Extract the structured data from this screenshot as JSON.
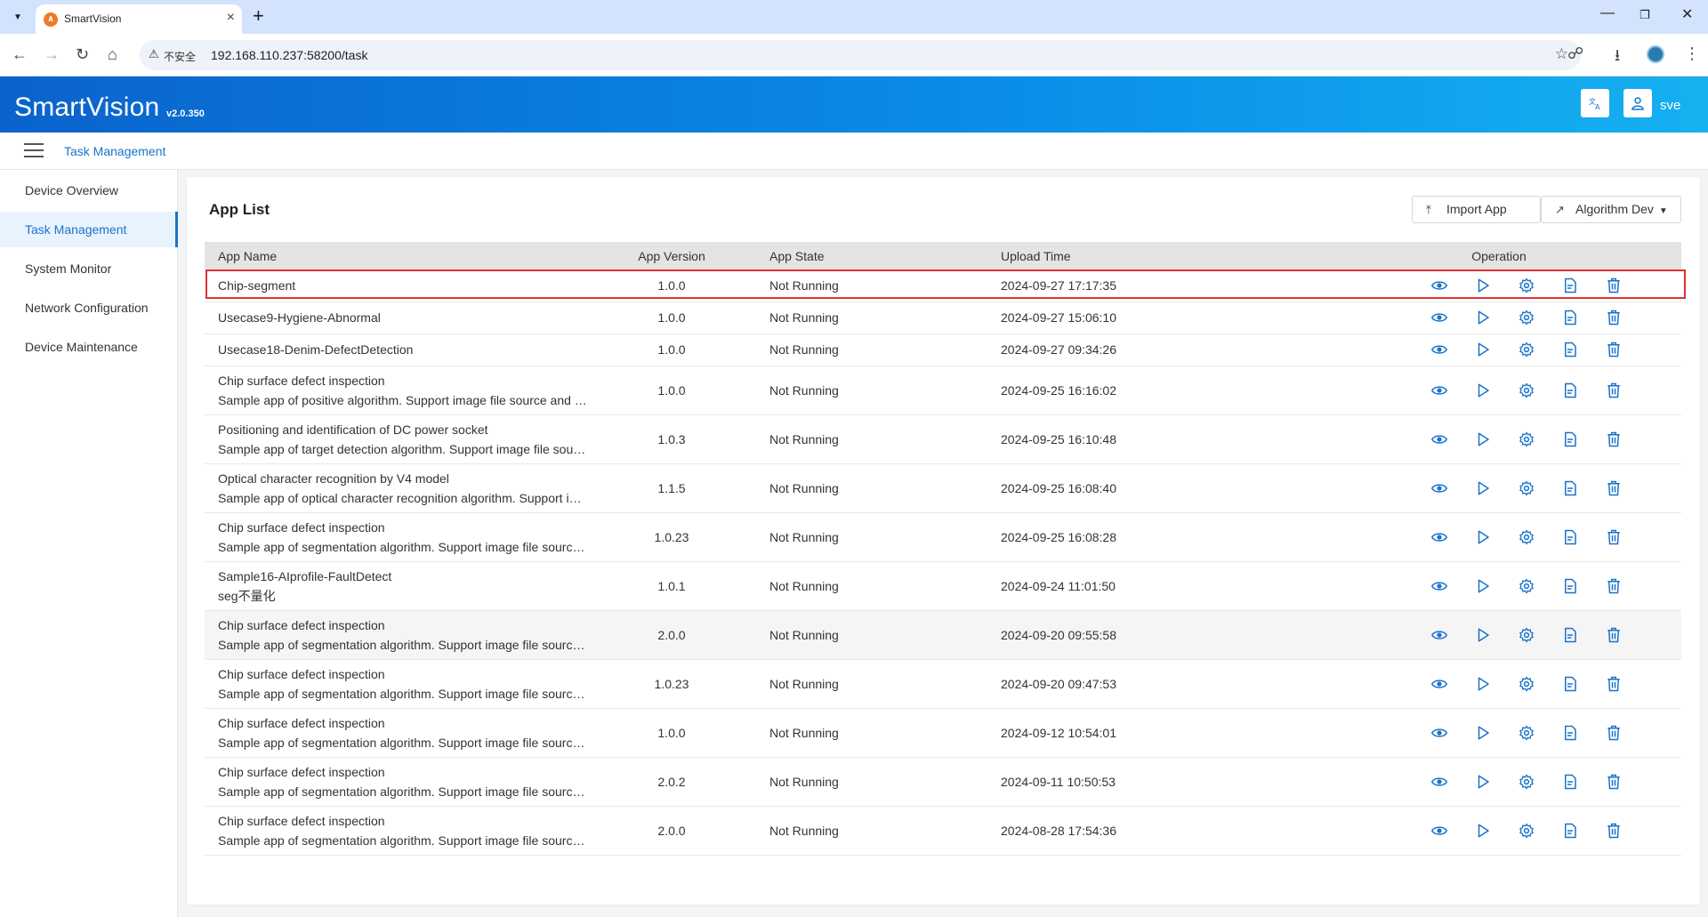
{
  "browser": {
    "tab_title": "SmartVision",
    "security_label": "不安全",
    "url": "192.168.110.237:58200/task"
  },
  "header": {
    "brand": "SmartVision",
    "version": "v2.0.350",
    "username": "sve"
  },
  "breadcrumb": {
    "current": "Task Management"
  },
  "sidebar": {
    "items": [
      {
        "label": "Device Overview",
        "active": false
      },
      {
        "label": "Task Management",
        "active": true
      },
      {
        "label": "System Monitor",
        "active": false
      },
      {
        "label": "Network Configuration",
        "active": false
      },
      {
        "label": "Device Maintenance",
        "active": false
      }
    ]
  },
  "main": {
    "title": "App List",
    "import_label": "Import App",
    "algo_label": "Algorithm Dev",
    "columns": {
      "name": "App Name",
      "version": "App Version",
      "state": "App State",
      "upload": "Upload Time",
      "operation": "Operation"
    },
    "rows": [
      {
        "name": "Chip-segment",
        "desc": "",
        "version": "1.0.0",
        "state": "Not Running",
        "upload": "2024-09-27 17:17:35"
      },
      {
        "name": "Usecase9-Hygiene-Abnormal",
        "desc": "",
        "version": "1.0.0",
        "state": "Not Running",
        "upload": "2024-09-27 15:06:10"
      },
      {
        "name": "Usecase18-Denim-DefectDetection",
        "desc": "",
        "version": "1.0.0",
        "state": "Not Running",
        "upload": "2024-09-27 09:34:26"
      },
      {
        "name": "Chip surface defect inspection",
        "desc": "Sample app of positive algorithm. Support image file source and c...",
        "version": "1.0.0",
        "state": "Not Running",
        "upload": "2024-09-25 16:16:02"
      },
      {
        "name": "Positioning and identification of DC power socket",
        "desc": "Sample app of target detection algorithm. Support image file sourc...",
        "version": "1.0.3",
        "state": "Not Running",
        "upload": "2024-09-25 16:10:48"
      },
      {
        "name": "Optical character recognition by V4 model",
        "desc": "Sample app of optical character recognition algorithm. Support ima...",
        "version": "1.1.5",
        "state": "Not Running",
        "upload": "2024-09-25 16:08:40"
      },
      {
        "name": "Chip surface defect inspection",
        "desc": "Sample app of segmentation algorithm. Support image file source ...",
        "version": "1.0.23",
        "state": "Not Running",
        "upload": "2024-09-25 16:08:28"
      },
      {
        "name": "Sample16-AIprofile-FaultDetect",
        "desc": "seg不量化",
        "version": "1.0.1",
        "state": "Not Running",
        "upload": "2024-09-24 11:01:50"
      },
      {
        "name": "Chip surface defect inspection",
        "desc": "Sample app of segmentation algorithm. Support image file source ...",
        "version": "2.0.0",
        "state": "Not Running",
        "upload": "2024-09-20 09:55:58"
      },
      {
        "name": "Chip surface defect inspection",
        "desc": "Sample app of segmentation algorithm. Support image file source ...",
        "version": "1.0.23",
        "state": "Not Running",
        "upload": "2024-09-20 09:47:53"
      },
      {
        "name": "Chip surface defect inspection",
        "desc": "Sample app of segmentation algorithm. Support image file source ...",
        "version": "1.0.0",
        "state": "Not Running",
        "upload": "2024-09-12 10:54:01"
      },
      {
        "name": "Chip surface defect inspection",
        "desc": "Sample app of segmentation algorithm. Support image file source ...",
        "version": "2.0.2",
        "state": "Not Running",
        "upload": "2024-09-11 10:50:53"
      },
      {
        "name": "Chip surface defect inspection",
        "desc": "Sample app of segmentation algorithm. Support image file source ...",
        "version": "2.0.0",
        "state": "Not Running",
        "upload": "2024-08-28 17:54:36"
      }
    ],
    "hovered_row": 8,
    "highlighted_row": 0,
    "operations": [
      "view-icon",
      "run-icon",
      "settings-icon",
      "log-icon",
      "delete-icon"
    ]
  },
  "colors": {
    "accent": "#1a73c9",
    "header_start": "#0a63cc",
    "header_end": "#16b0f0",
    "highlight_border": "#e03131"
  }
}
